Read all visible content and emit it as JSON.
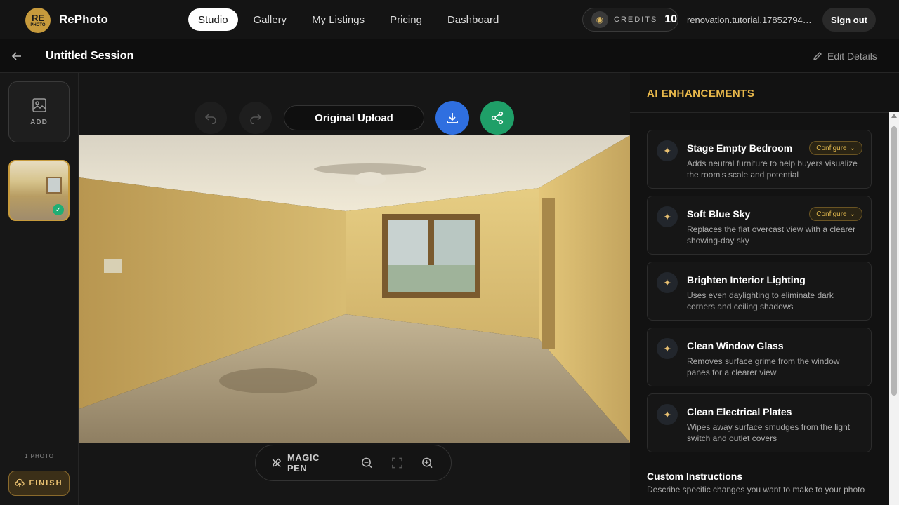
{
  "brand": {
    "logo_text": "RE",
    "logo_sub": "PHOTO",
    "name": "RePhoto"
  },
  "nav": [
    {
      "label": "Studio",
      "active": true
    },
    {
      "label": "Gallery"
    },
    {
      "label": "My Listings"
    },
    {
      "label": "Pricing"
    },
    {
      "label": "Dashboard"
    }
  ],
  "credits": {
    "label": "CREDITS",
    "value": "10"
  },
  "user": {
    "email": "renovation.tutorial.1785279469..."
  },
  "signout_label": "Sign out",
  "session": {
    "title": "Untitled Session",
    "edit_label": "Edit Details"
  },
  "sidebar": {
    "add_label": "ADD",
    "photo_count": "1 PHOTO",
    "finish_label": "FINISH"
  },
  "canvas": {
    "version_label": "Original Upload"
  },
  "toolbar": {
    "magic_pen_label": "MAGIC PEN"
  },
  "panel": {
    "title": "AI ENHANCEMENTS",
    "configure_label": "Configure",
    "cards": [
      {
        "title": "Stage Empty Bedroom",
        "desc": "Adds neutral furniture to help buyers visualize the room's scale and potential",
        "configurable": true
      },
      {
        "title": "Soft Blue Sky",
        "desc": "Replaces the flat overcast view with a clearer showing-day sky",
        "configurable": true
      },
      {
        "title": "Brighten Interior Lighting",
        "desc": "Uses even daylighting to eliminate dark corners and ceiling shadows",
        "configurable": false
      },
      {
        "title": "Clean Window Glass",
        "desc": "Removes surface grime from the window panes for a clearer view",
        "configurable": false
      },
      {
        "title": "Clean Electrical Plates",
        "desc": "Wipes away surface smudges from the light switch and outlet covers",
        "configurable": false
      }
    ],
    "custom_title": "Custom Instructions",
    "custom_desc": "Describe specific changes you want to make to your photo"
  },
  "colors": {
    "accent": "#e8b84b",
    "download": "#2f6fe0",
    "share": "#1f9f68"
  }
}
